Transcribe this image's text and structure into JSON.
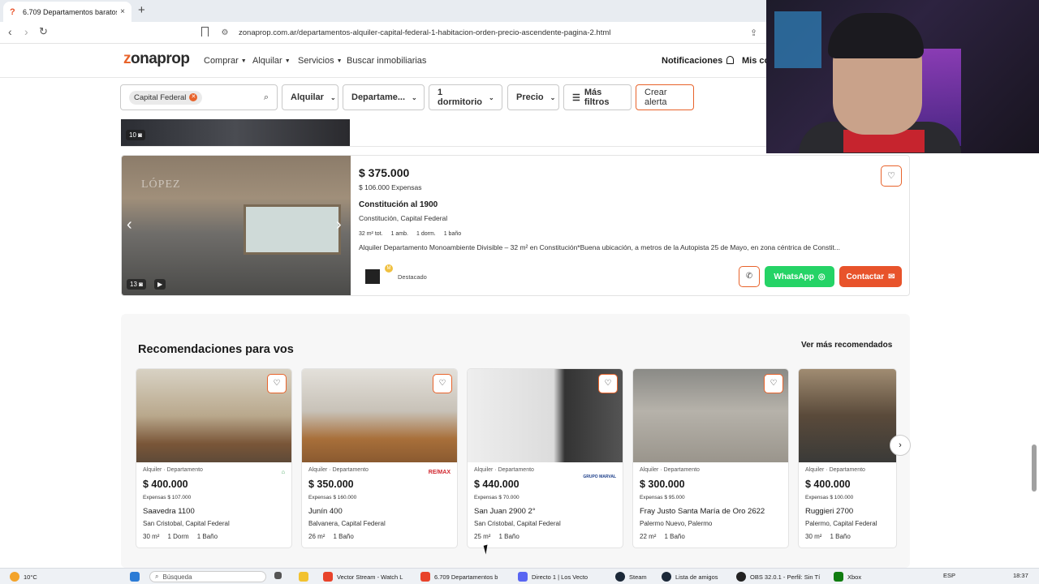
{
  "browser": {
    "tab_title": "6.709 Departamentos baratos",
    "tab_close": "×",
    "new_tab": "+",
    "url": "zonaprop.com.ar/departamentos-alquiler-capital-federal-1-habitacion-orden-precio-ascendente-pagina-2.html",
    "back": "‹",
    "forward": "›",
    "reload": "↻"
  },
  "header": {
    "logo_z": "z",
    "logo_rest": "onaprop",
    "nav": [
      "Comprar",
      "Alquilar",
      "Servicios",
      "Buscar inmobiliarias"
    ],
    "notifications": "Notificaciones",
    "user": "Mis co"
  },
  "filters": {
    "location_chip": "Capital Federal",
    "operation": "Alquilar",
    "property_type": "Departame...",
    "rooms": "1 dormitorio",
    "price": "Precio",
    "more": "Más filtros",
    "alert": "Crear alerta"
  },
  "prev_listing": {
    "photo_count": "10"
  },
  "listing": {
    "price": "$ 375.000",
    "expenses": "$ 106.000 Expensas",
    "address": "Constitución al 1900",
    "location": "Constitución, Capital Federal",
    "features": [
      "32 m² tot.",
      "1 amb.",
      "1 dorm.",
      "1 baño"
    ],
    "description": "Alquiler Departamento Monoambiente Divisible – 32 m² en Constitución*Buena ubicación, a metros de la Autopista 25 de Mayo, en zona céntrica de Constit...",
    "photo_count": "13",
    "watermark": "LÓPEZ",
    "featured_label": "Destacado",
    "whatsapp": "WhatsApp",
    "contact": "Contactar"
  },
  "recommendations": {
    "title": "Recomendaciones para vos",
    "more": "Ver más recomendados",
    "cards": [
      {
        "type": "Alquiler · Departamento",
        "price": "$ 400.000",
        "expenses": "Expensas $ 107.000",
        "address": "Saavedra 1100",
        "location": "San Cristobal, Capital Federal",
        "area": "30 m²",
        "rooms": "1 Dorm",
        "baths": "1 Baño",
        "logo": "",
        "logo_color": "#2e9b4a"
      },
      {
        "type": "Alquiler · Departamento",
        "price": "$ 350.000",
        "expenses": "Expensas $ 160.000",
        "address": "Junín 400",
        "location": "Balvanera, Capital Federal",
        "area": "26 m²",
        "rooms": "1 Baño",
        "baths": "",
        "logo": "RE/MAX",
        "logo_color": "#d1262e"
      },
      {
        "type": "Alquiler · Departamento",
        "price": "$ 440.000",
        "expenses": "Expensas $ 70.000",
        "address": "San Juan 2900 2°",
        "location": "San Cristobal, Capital Federal",
        "area": "25 m²",
        "rooms": "1 Baño",
        "baths": "",
        "logo": "GRUPO MARVAL",
        "logo_color": "#1d3f8a"
      },
      {
        "type": "Alquiler · Departamento",
        "price": "$ 300.000",
        "expenses": "Expensas $ 95.000",
        "address": "Fray Justo Santa María de Oro 2622",
        "location": "Palermo Nuevo, Palermo",
        "area": "22 m²",
        "rooms": "1 Baño",
        "baths": "",
        "logo": "",
        "logo_color": "#444"
      },
      {
        "type": "Alquiler · Departamento",
        "price": "$ 400.000",
        "expenses": "Expensas $ 100.000",
        "address": "Ruggieri 2700",
        "location": "Palermo, Capital Federal",
        "area": "30 m²",
        "rooms": "1 Baño",
        "baths": "",
        "logo": "",
        "logo_color": "#444"
      }
    ]
  },
  "taskbar": {
    "weather_temp": "10°C",
    "search": "Búsqueda",
    "items": [
      "Vector Stream - Watch L",
      "6.709 Departamentos b",
      "Directo 1 | Los Vecto",
      "Steam",
      "Lista de amigos",
      "OBS 32.0.1 - Perfil: Sin Tí",
      "Xbox"
    ],
    "lang": "ESP",
    "time": "18:37"
  },
  "colors": {
    "brand": "#e8632b",
    "whatsapp": "#25d366",
    "contact": "#e8532b"
  }
}
